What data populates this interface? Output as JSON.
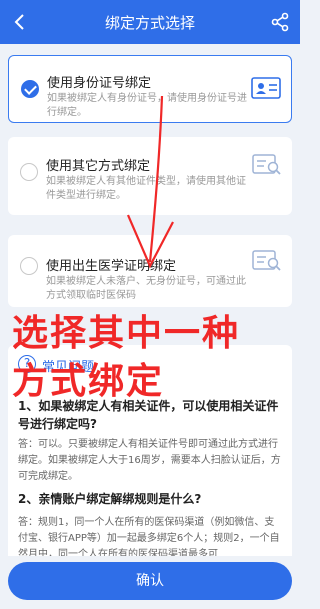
{
  "header": {
    "title": "绑定方式选择"
  },
  "options": [
    {
      "title": "使用身份证号绑定",
      "desc": "如果被绑定人有身份证号，请使用身份证号进行绑定。",
      "selected": true,
      "icon": "id-card-icon"
    },
    {
      "title": "使用其它方式绑定",
      "desc": "如果被绑定人有其他证件类型，请使用其他证件类型进行绑定。",
      "selected": false,
      "icon": "card-search-icon"
    },
    {
      "title": "使用出生医学证明绑定",
      "desc": "如果被绑定人未落户、无身份证号，可通过此方式领取临时医保码",
      "selected": false,
      "icon": "card-search-icon"
    }
  ],
  "overlay": {
    "line1": "选择其中一种",
    "line2": "方式绑定"
  },
  "faq": {
    "title": "常见问题",
    "q1": "1、如果被绑定人有相关证件，可以使用相关证件号进行绑定吗?",
    "a1": "答：可以。只要被绑定人有相关证件号即可通过此方式进行绑定。如果被绑定人大于16周岁，需要本人扫脸认证后，方可完成绑定。",
    "q2": "2、亲情账户绑定解绑规则是什么?",
    "a2": "答：规则1，同一个人在所有的医保码渠道（例如微信、支付宝、银行APP等）加一起最多绑定6个人；规则2，一个自然月中，同一个人在所有的医保码渠道最多可"
  },
  "footer": {
    "confirm_label": "确认"
  },
  "colors": {
    "primary": "#2f6ee8",
    "overlay_red": "#f02828"
  }
}
